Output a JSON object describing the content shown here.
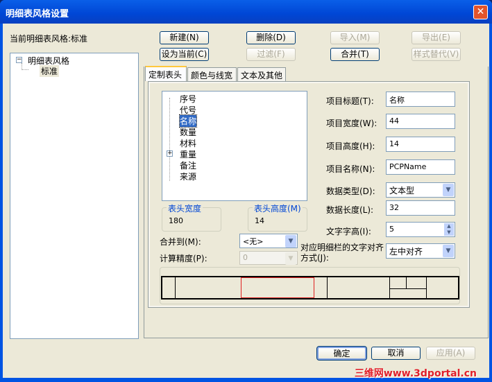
{
  "window": {
    "title": "明细表风格设置",
    "close_label": "✕"
  },
  "current_style_label": "当前明细表风格:标准",
  "tree": {
    "root": "明细表风格",
    "children": [
      "标准"
    ]
  },
  "toolbar": {
    "new": "新建(N)",
    "delete": "删除(D)",
    "import": "导入(M)",
    "export": "导出(E)",
    "set_current": "设为当前(C)",
    "filter": "过滤(F)",
    "merge": "合并(T)",
    "style_replace": "样式替代(V)"
  },
  "tabs": [
    "定制表头",
    "颜色与线宽",
    "文本及其他"
  ],
  "header_items": [
    "序号",
    "代号",
    "名称",
    "数量",
    "材料",
    "重量",
    "备注",
    "来源"
  ],
  "selected_item": "名称",
  "header_width": {
    "label": "表头宽度",
    "value": "180"
  },
  "header_height": {
    "label": "表头高度(M)",
    "value": "14"
  },
  "merge_to": {
    "label": "合并到(M):",
    "value": "<无>"
  },
  "precision": {
    "label": "计算精度(P):",
    "value": "0"
  },
  "fields": {
    "title": {
      "label": "项目标题(T):",
      "value": "名称"
    },
    "width": {
      "label": "项目宽度(W):",
      "value": "44"
    },
    "height": {
      "label": "项目高度(H):",
      "value": "14"
    },
    "name": {
      "label": "项目名称(N):",
      "value": "PCPName"
    },
    "data_type": {
      "label": "数据类型(D):",
      "value": "文本型"
    },
    "data_length": {
      "label": "数据长度(L):",
      "value": "32"
    },
    "text_height": {
      "label": "文字字高(I):",
      "value": "5"
    },
    "align": {
      "label1": "对应明细栏的文字对齐",
      "label2": "方式(J):",
      "value": "左中对齐"
    }
  },
  "footer": {
    "ok": "确定",
    "cancel": "取消",
    "apply": "应用(A)"
  },
  "watermark": "三维网www.3dportal.cn",
  "colors": {
    "selection": "#316ac5",
    "preview_highlight": "#e02020"
  }
}
